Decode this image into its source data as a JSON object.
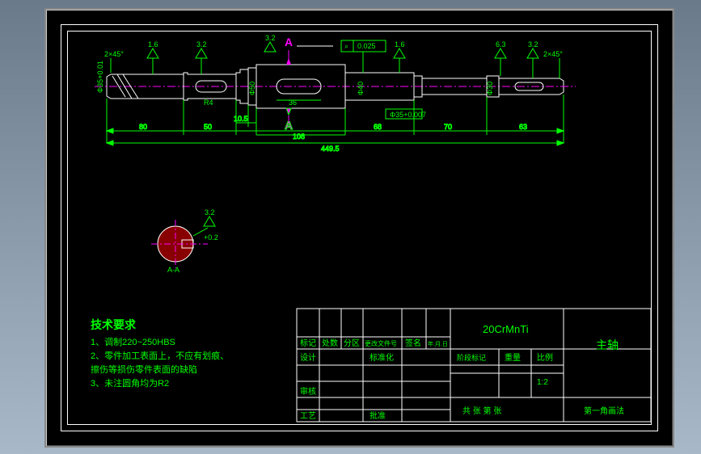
{
  "dims": {
    "chamfer_left": "2×45°",
    "ra1": "1.6",
    "ra2": "3.2",
    "ra3_top": "3.2",
    "section_a1": "A",
    "section_a2": "A",
    "runout": "0.025",
    "ra4": "1.6",
    "ra5": "6.3",
    "ra6": "3.2",
    "chamfer_right": "2×45°",
    "dia_left": "Φ35+0.01",
    "key_r": "R4",
    "dia_mid1": "Φ50",
    "slot_w": "36",
    "dia_mid2": "Φ40",
    "dia_tol": "Φ35+0.007",
    "dia_right": "Φ30",
    "seg1": "80",
    "seg2": "50",
    "seg3": "10.5",
    "seg4": "108",
    "seg5": "68",
    "seg6": "70",
    "seg7": "63",
    "total": "449.5",
    "sec_ra": "3.2",
    "sec_tol": "+0.2",
    "sec_label": "A-A"
  },
  "req": {
    "title": "技术要求",
    "line1": "1、调制220~250HBS",
    "line2": "2、零件加工表面上，不应有划痕、",
    "line2b": "擦伤等损伤零件表面的缺陷",
    "line3": "3、未注圆角均为R2"
  },
  "tb": {
    "material": "20CrMnTi",
    "part": "主轴",
    "h_mark": "标记",
    "h_count": "处数",
    "h_zone": "分区",
    "h_change": "更改文件号",
    "h_sign": "签名",
    "h_date": "年.月.日",
    "design": "设计",
    "std": "标准化",
    "stage": "阶段标记",
    "weight": "重量",
    "scale": "比例",
    "scale_val": "1:2",
    "check": "审核",
    "craft": "工艺",
    "approve": "批准",
    "sheet": "共   张  第   张",
    "proj": "第一角画法"
  }
}
